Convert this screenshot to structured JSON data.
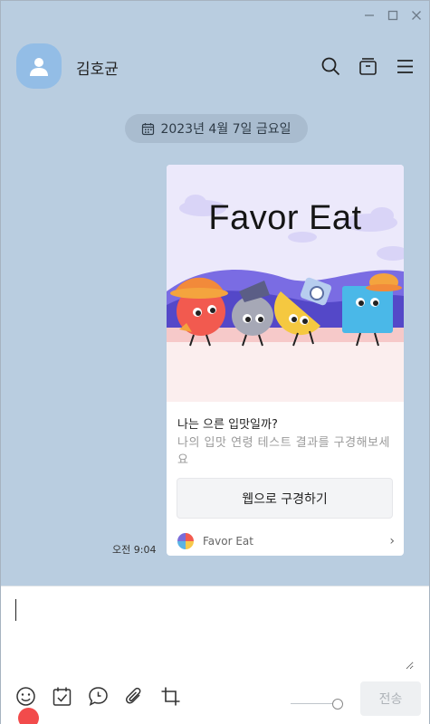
{
  "window": {
    "controls": [
      "minimize",
      "maximize",
      "close"
    ]
  },
  "header": {
    "name": "김호균",
    "icons": [
      "search-icon",
      "drawer-icon",
      "menu-icon"
    ]
  },
  "date_pill": {
    "text": "2023년 4월 7일 금요일"
  },
  "card": {
    "banner_title": "Favor Eat",
    "question": "나는 으른 입맛일까?",
    "description": "나의 입맛 연령 테스트 결과를 구경해보세요",
    "button_label": "웹으로 구경하기",
    "app_name": "Favor Eat",
    "chevron": "›"
  },
  "message_time": "오전 9:04",
  "compose": {
    "input_value": "",
    "toolbar_icons": [
      "emoticon-icon",
      "calendar-check-icon",
      "speech-bubble-icon",
      "paperclip-icon",
      "crop-icon"
    ],
    "emoticon_has_notification": true,
    "send_label": "전송"
  }
}
